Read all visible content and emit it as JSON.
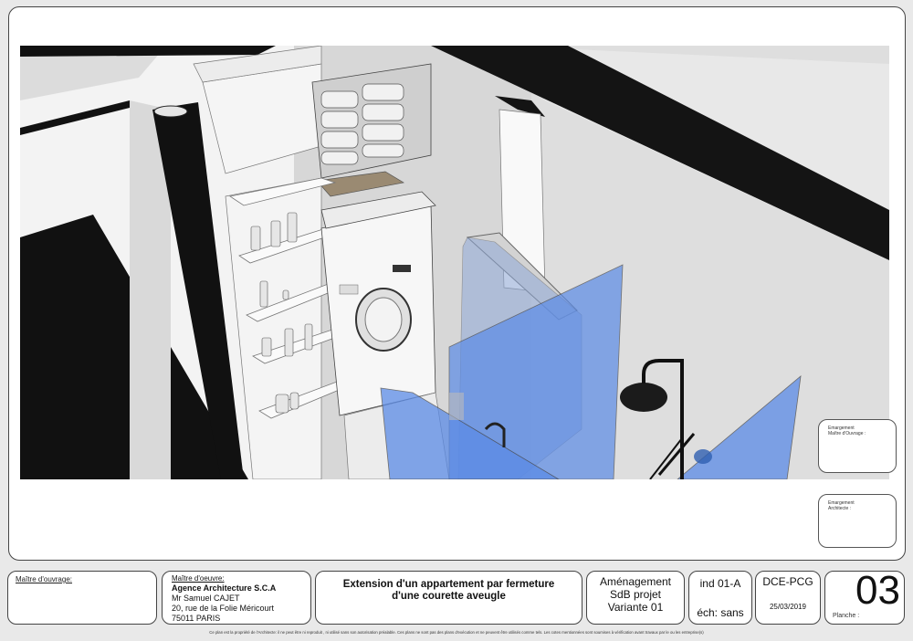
{
  "stamps": {
    "upper": "Emargement\nMaître d'Ouvrage :",
    "lower": "Emargement\nArchitecte :"
  },
  "title_block": {
    "maitre_ouvrage_label": "Maître d'ouvrage:",
    "maitre_oeuvre": {
      "label": "Maître d'oeuvre:",
      "firm": "Agence Architecture S.C.A",
      "person": "Mr Samuel CAJET",
      "street": "20, rue de la Folie Méricourt",
      "city": "75011 PARIS"
    },
    "project_title_line1": "Extension d'un appartement par fermeture",
    "project_title_line2": "d'une courette aveugle",
    "subject_line1": "Aménagement",
    "subject_line2": "SdB projet",
    "subject_line3": "Variante 01",
    "index": "ind 01-A",
    "scale": "éch: sans",
    "phase": "DCE-PCG",
    "date": "25/03/2019",
    "planche_label": "Planche :",
    "planche_number": "03"
  },
  "disclaimer": "Ce plan est la propriété de l'Architecte: il ne peut être ni reproduit , ni utilisé sans son autorisation préalable. Ces plans ne sont pas des plans d'exécution et ne peuvent être utilisés comme tels. Les cotes mentionnées sont soumises à vérification avant travaux par le ou les entreprise(s)"
}
